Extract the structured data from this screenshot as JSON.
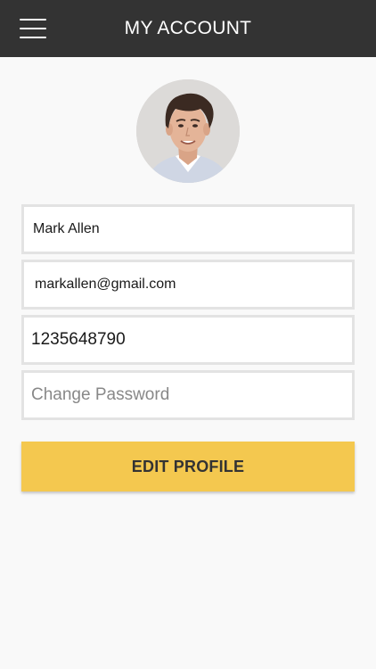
{
  "header": {
    "title": "MY ACCOUNT",
    "menu_icon": "hamburger-menu-icon"
  },
  "profile": {
    "avatar_icon": "user-avatar-photo"
  },
  "form": {
    "name_value": "Mark Allen",
    "email_value": "markallen@gmail.com",
    "phone_value": "1235648790",
    "password_placeholder": "Change Password"
  },
  "actions": {
    "edit_label": "EDIT PROFILE"
  },
  "colors": {
    "header_bg": "#333333",
    "accent_button": "#f4c84f",
    "page_bg": "#f9f9f9"
  }
}
